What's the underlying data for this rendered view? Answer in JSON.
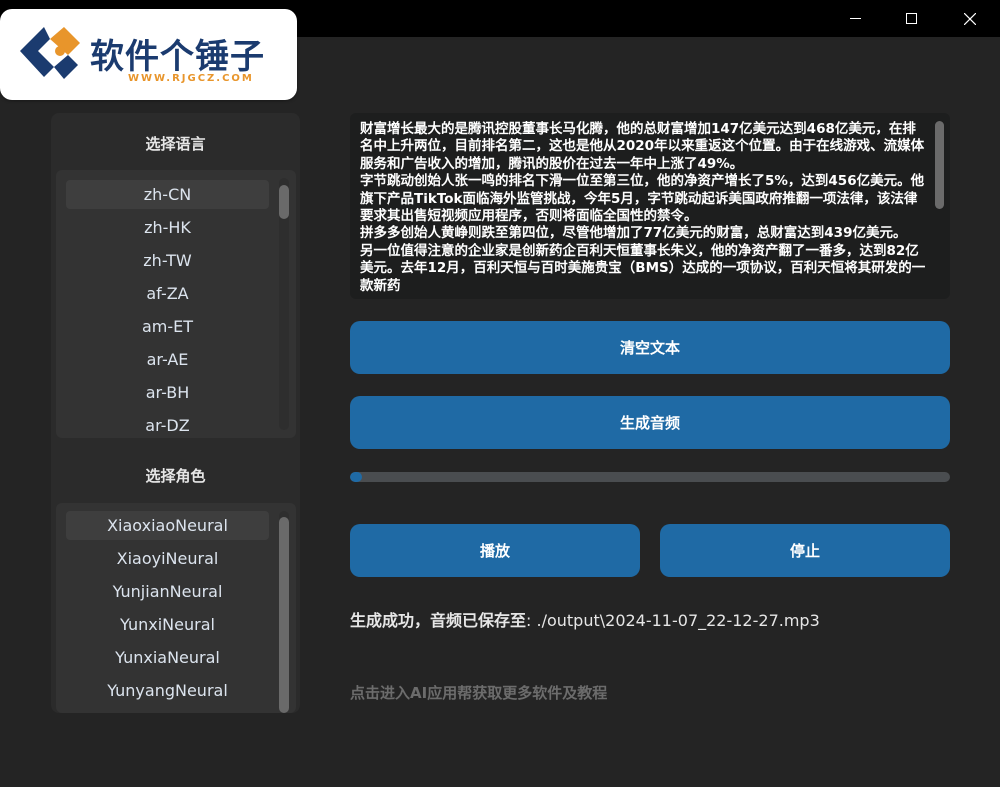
{
  "window": {
    "controls": {
      "minimize_icon": "minimize-icon",
      "maximize_icon": "maximize-icon",
      "close_icon": "close-icon"
    }
  },
  "logo": {
    "brand_cn": "软件个锤子",
    "url": "WWW.RJGCZ.COM",
    "colors": {
      "navy": "#1b3b6f",
      "orange": "#e8952b"
    }
  },
  "language_section": {
    "title": "选择语言",
    "items": [
      "zh-CN",
      "zh-HK",
      "zh-TW",
      "af-ZA",
      "am-ET",
      "ar-AE",
      "ar-BH",
      "ar-DZ"
    ],
    "selected": "zh-CN"
  },
  "role_section": {
    "title": "选择角色",
    "items": [
      "XiaoxiaoNeural",
      "XiaoyiNeural",
      "YunjianNeural",
      "YunxiNeural",
      "YunxiaNeural",
      "YunyangNeural"
    ],
    "selected": "XiaoxiaoNeural"
  },
  "text_input": {
    "value": "财富增长最大的是腾讯控股董事长马化腾，他的总财富增加147亿美元达到468亿美元，在排名中上升两位，目前排名第二，这也是他从2020年以来重返这个位置。由于在线游戏、流媒体服务和广告收入的增加，腾讯的股价在过去一年中上涨了49%。\n字节跳动创始人张一鸣的排名下滑一位至第三位，他的净资产增长了5%，达到456亿美元。他旗下产品TikTok面临海外监管挑战，今年5月，字节跳动起诉美国政府推翻一项法律，该法律要求其出售短视频应用程序，否则将面临全国性的禁令。\n拼多多创始人黄峥则跌至第四位，尽管他增加了77亿美元的财富，总财富达到439亿美元。\n另一位值得注意的企业家是创新药企百利天恒董事长朱义，他的净资产翻了一番多，达到82亿美元。去年12月，百利天恒与百时美施贵宝（BMS）达成的一项协议，百利天恒将其研发的一款新药"
  },
  "buttons": {
    "clear": "清空文本",
    "generate": "生成音频",
    "play": "播放",
    "stop": "停止"
  },
  "progress": {
    "value": 0.02,
    "color": "#1f6aa5"
  },
  "status": {
    "lead": "生成成功，音频已保存至",
    "path": ": ./output\\2024-11-07_22-12-27.mp3"
  },
  "footer": {
    "link_text": "点击进入AI应用帮获取更多软件及教程"
  },
  "colors": {
    "accent": "#1f6aa5",
    "background": "#242424",
    "panel": "#2b2b2b"
  }
}
